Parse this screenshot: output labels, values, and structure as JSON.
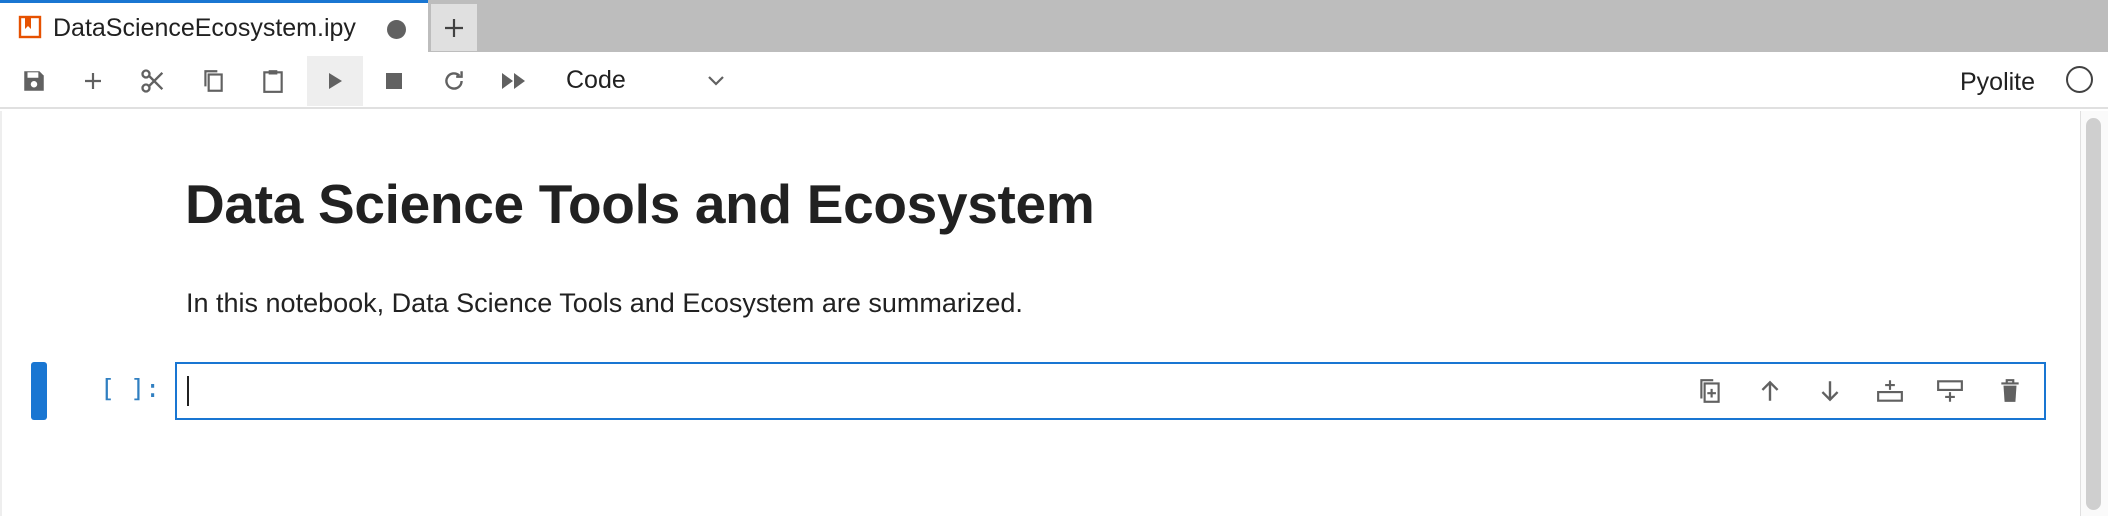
{
  "tab": {
    "title": "DataScienceEcosystem.ipy",
    "icon": "notebook-icon",
    "accent_color": "#1976d2",
    "icon_color": "#e65100"
  },
  "toolbar": {
    "buttons": [
      "save-icon",
      "add-icon",
      "cut-icon",
      "copy-icon",
      "paste-icon",
      "run-icon",
      "stop-icon",
      "restart-icon",
      "fast-forward-icon"
    ],
    "cell_type": "Code",
    "kernel_name": "Pyolite"
  },
  "notebook": {
    "heading": "Data Science Tools and Ecosystem",
    "paragraph": "In this notebook, Data Science Tools and Ecosystem are summarized.",
    "cell": {
      "prompt": "[ ]:",
      "source": "",
      "actions": [
        "duplicate-icon",
        "move-up-icon",
        "move-down-icon",
        "insert-above-icon",
        "insert-below-icon",
        "delete-icon"
      ]
    }
  }
}
